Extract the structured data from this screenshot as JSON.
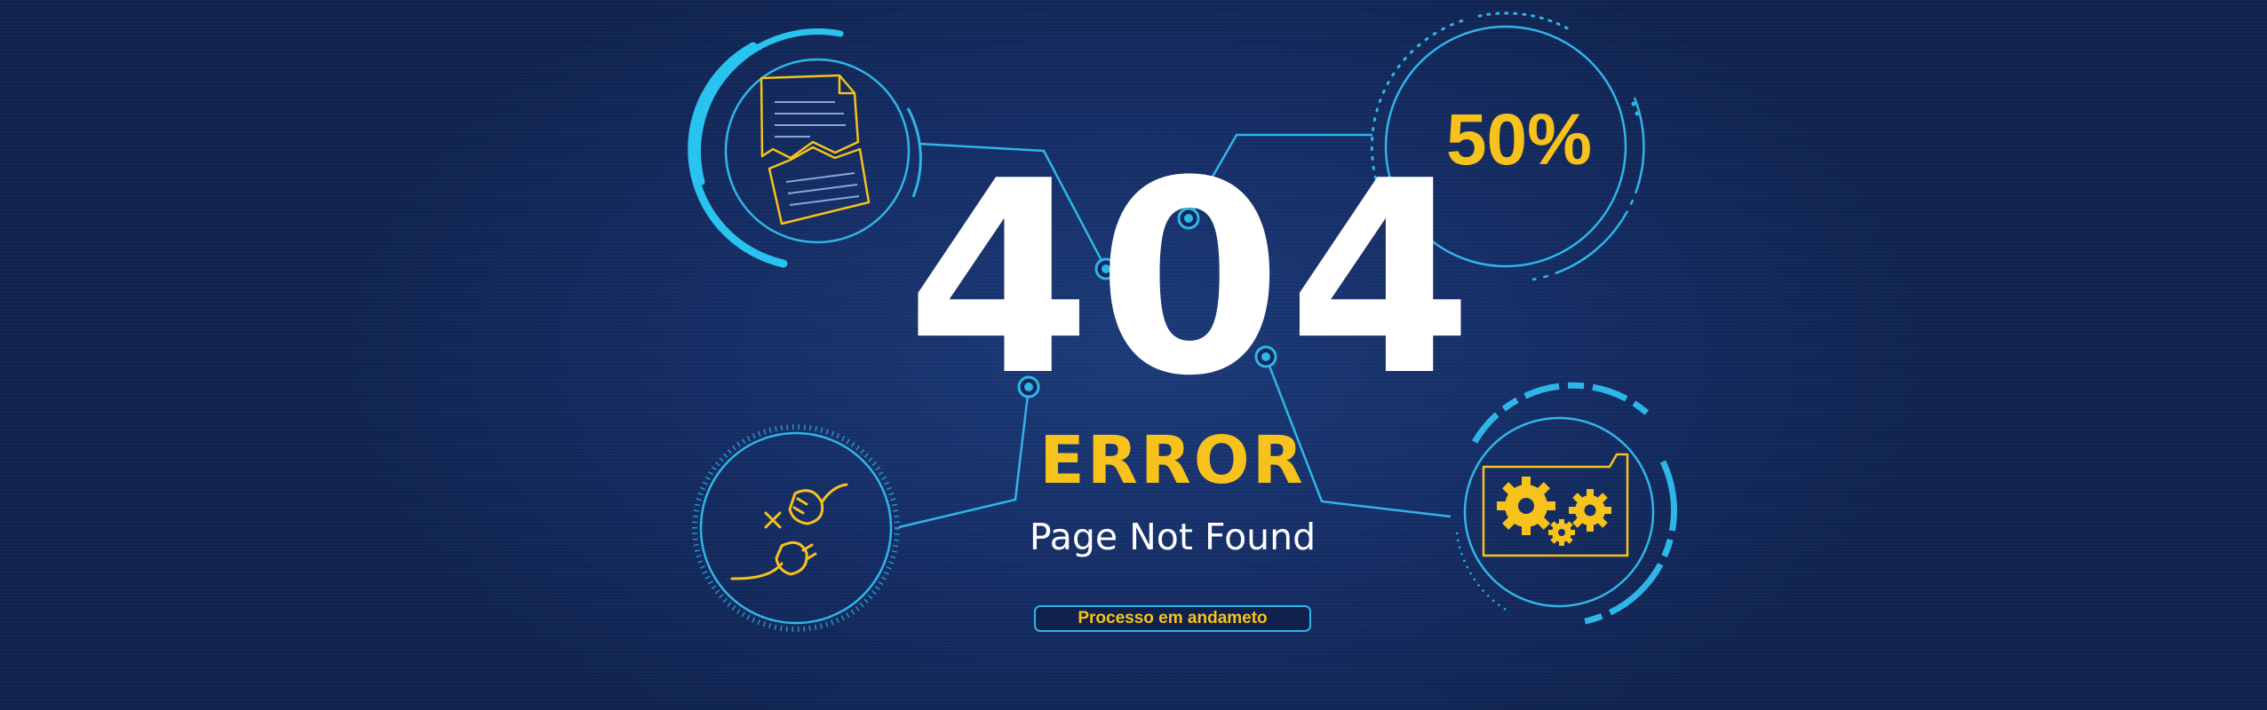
{
  "error_page": {
    "code": "404",
    "error_label": "ERROR",
    "message": "Page Not Found",
    "status_text": "Processo em andameto",
    "progress_label": "50%",
    "progress_fraction": 0.5
  },
  "icons": {
    "top_left": "torn-document-icon",
    "top_right": "progress-percent-gauge",
    "bottom_left": "unplugged-cable-icon",
    "bottom_right": "folder-gears-icon"
  },
  "colors": {
    "background": "#13275a",
    "accent_cyan": "#2fb6e8",
    "accent_yellow": "#f7c21b",
    "text_white": "#ffffff"
  }
}
